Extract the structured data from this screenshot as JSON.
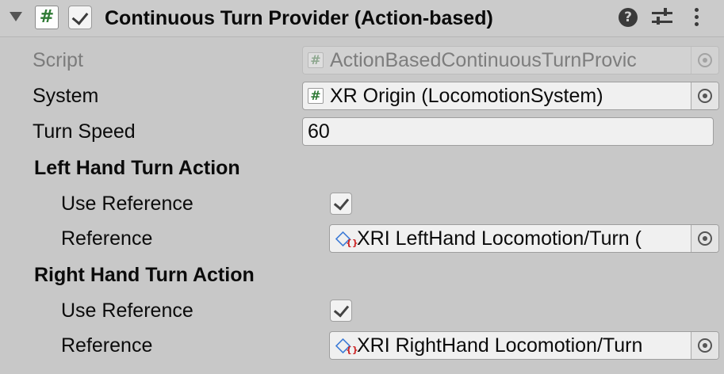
{
  "component": {
    "title": "Continuous Turn Provider (Action-based)",
    "enabled": true,
    "script_icon": "script-hash-icon"
  },
  "properties": {
    "script": {
      "label": "Script",
      "value": "ActionBasedContinuousTurnProvic",
      "icon": "#"
    },
    "system": {
      "label": "System",
      "value": "XR Origin (LocomotionSystem)",
      "icon": "#"
    },
    "turn_speed": {
      "label": "Turn Speed",
      "value": "60"
    }
  },
  "left_hand": {
    "header": "Left Hand Turn Action",
    "use_reference_label": "Use Reference",
    "use_reference": true,
    "reference_label": "Reference",
    "reference_value": "XRI LeftHand Locomotion/Turn ("
  },
  "right_hand": {
    "header": "Right Hand Turn Action",
    "use_reference_label": "Use Reference",
    "use_reference": true,
    "reference_label": "Reference",
    "reference_value": "XRI RightHand Locomotion/Turn"
  },
  "icons": {
    "help": "?",
    "hash": "#"
  }
}
